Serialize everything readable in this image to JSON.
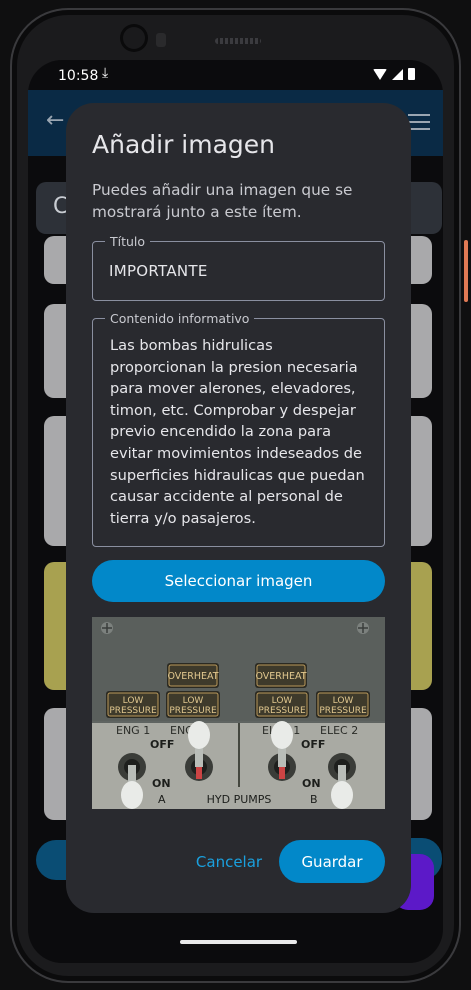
{
  "status_bar": {
    "time": "10:58",
    "icons": [
      "download-icon",
      "wifi-icon",
      "signal-icon",
      "battery-icon"
    ]
  },
  "background_app": {
    "header_initial": "C"
  },
  "dialog": {
    "title": "Añadir imagen",
    "description": "Puedes añadir una imagen que se mostrará junto a este ítem.",
    "title_field": {
      "label": "Título",
      "value": "IMPORTANTE"
    },
    "content_field": {
      "label": "Contenido informativo",
      "value": "Las bombas hidrulicas proporcionan la presion necesaria para mover alerones, elevadores, timon, etc. Comprobar y despejar previo encendido la zona para evitar movimientos indeseados de superficies hidraulicas que puedan causar accidente al personal de tierra y/o pasajeros."
    },
    "select_image_label": "Seleccionar imagen",
    "cancel_label": "Cancelar",
    "save_label": "Guardar",
    "image": {
      "panel_labels": {
        "overheat": "OVERHEAT",
        "low": "LOW",
        "pressure": "PRESSURE",
        "eng1": "ENG 1",
        "eng2": "ENG 2",
        "elec1": "ELEC 1",
        "elec2": "ELEC 2",
        "off": "OFF",
        "on": "ON",
        "a": "A",
        "b": "B",
        "hyd_pumps": "HYD PUMPS"
      }
    }
  },
  "colors": {
    "accent": "#0288c9",
    "dialog_bg": "#292a2f",
    "app_bar": "#0a2a45"
  }
}
